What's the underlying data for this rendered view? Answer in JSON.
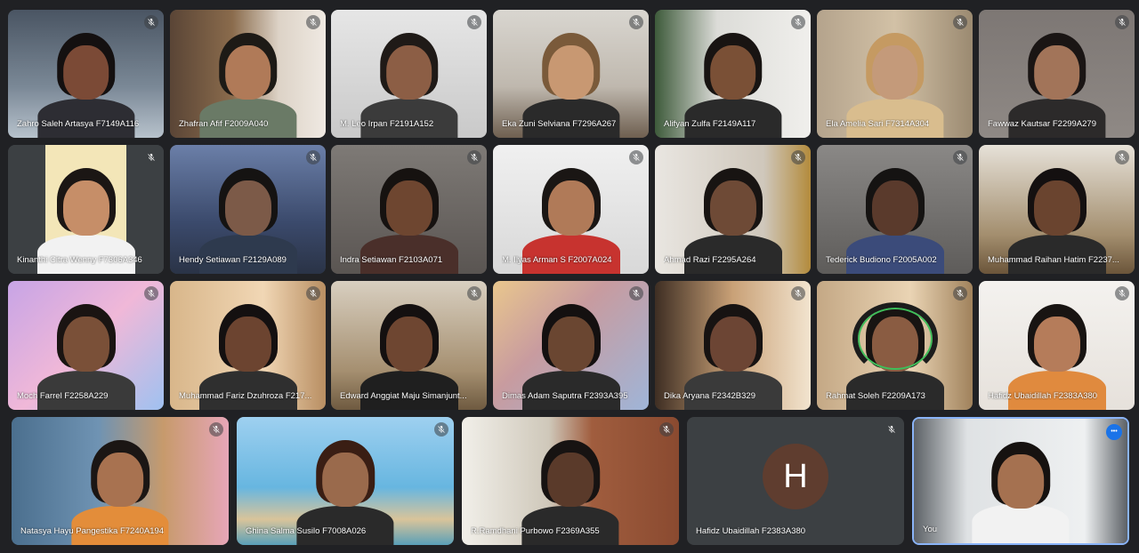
{
  "participants": [
    {
      "name": "Zahro Saleh Artasya F7149A116",
      "mic": "mic-off-icon"
    },
    {
      "name": "Zhafran Afif F2009A040",
      "mic": "mic-off-icon"
    },
    {
      "name": "M. Leo Irpan F2191A152",
      "mic": "mic-off-icon"
    },
    {
      "name": "Eka Zuni Selviana F7296A267",
      "mic": "mic-off-icon"
    },
    {
      "name": "Alifyan Zulfa F2149A117",
      "mic": "mic-off-icon"
    },
    {
      "name": "Ela Amelia Sari F7314A304",
      "mic": "mic-off-icon"
    },
    {
      "name": "Fawwaz Kautsar F2299A279",
      "mic": "mic-off-icon"
    },
    {
      "name": "Kinanthi Citra Wenny F7306A346",
      "mic": "mic-off-icon"
    },
    {
      "name": "Hendy Setiawan F2129A089",
      "mic": "mic-off-icon"
    },
    {
      "name": "Indra Setiawan F2103A071",
      "mic": "mic-off-icon"
    },
    {
      "name": "M. Ilyas Arman S F2007A024",
      "mic": "mic-off-icon"
    },
    {
      "name": "Ahmad Razi F2295A264",
      "mic": "mic-off-icon"
    },
    {
      "name": "Tederick Budiono F2005A002",
      "mic": "mic-off-icon"
    },
    {
      "name": "Muhammad Raihan Hatim F2237...",
      "mic": "mic-off-icon"
    },
    {
      "name": "Moch Farrel F2258A229",
      "mic": "mic-off-icon"
    },
    {
      "name": "Muhammad Fariz Dzuhroza F217...",
      "mic": "mic-off-icon"
    },
    {
      "name": "Edward Anggiat Maju Simanjunt...",
      "mic": "mic-off-icon"
    },
    {
      "name": "Dimas Adam Saputra F2393A395",
      "mic": "mic-off-icon"
    },
    {
      "name": "Dika Aryana F2342B329",
      "mic": "mic-off-icon"
    },
    {
      "name": "Rahmat Soleh F2209A173",
      "mic": "mic-off-icon"
    },
    {
      "name": "Hafidz Ubaidillah F2383A380",
      "mic": "mic-off-icon"
    },
    {
      "name": "Natasya Hayu Pangestika F7240A194",
      "mic": "mic-off-icon"
    },
    {
      "name": "Ghina Salma Susilo F7008A026",
      "mic": "mic-off-icon"
    },
    {
      "name": "R.Ramdhani Purbowo F2369A355",
      "mic": "mic-off-icon"
    },
    {
      "name": "Hafidz Ubaidillah F2383A380",
      "mic": "mic-off-icon",
      "avatar_letter": "H",
      "avatar_color": "#5f3d2f"
    },
    {
      "name": "You",
      "more": "more-options-icon"
    }
  ],
  "colors": {
    "background": "#202124",
    "tile": "#3c4043",
    "self_border": "#8ab4f8",
    "more_button": "#1a73e8"
  }
}
